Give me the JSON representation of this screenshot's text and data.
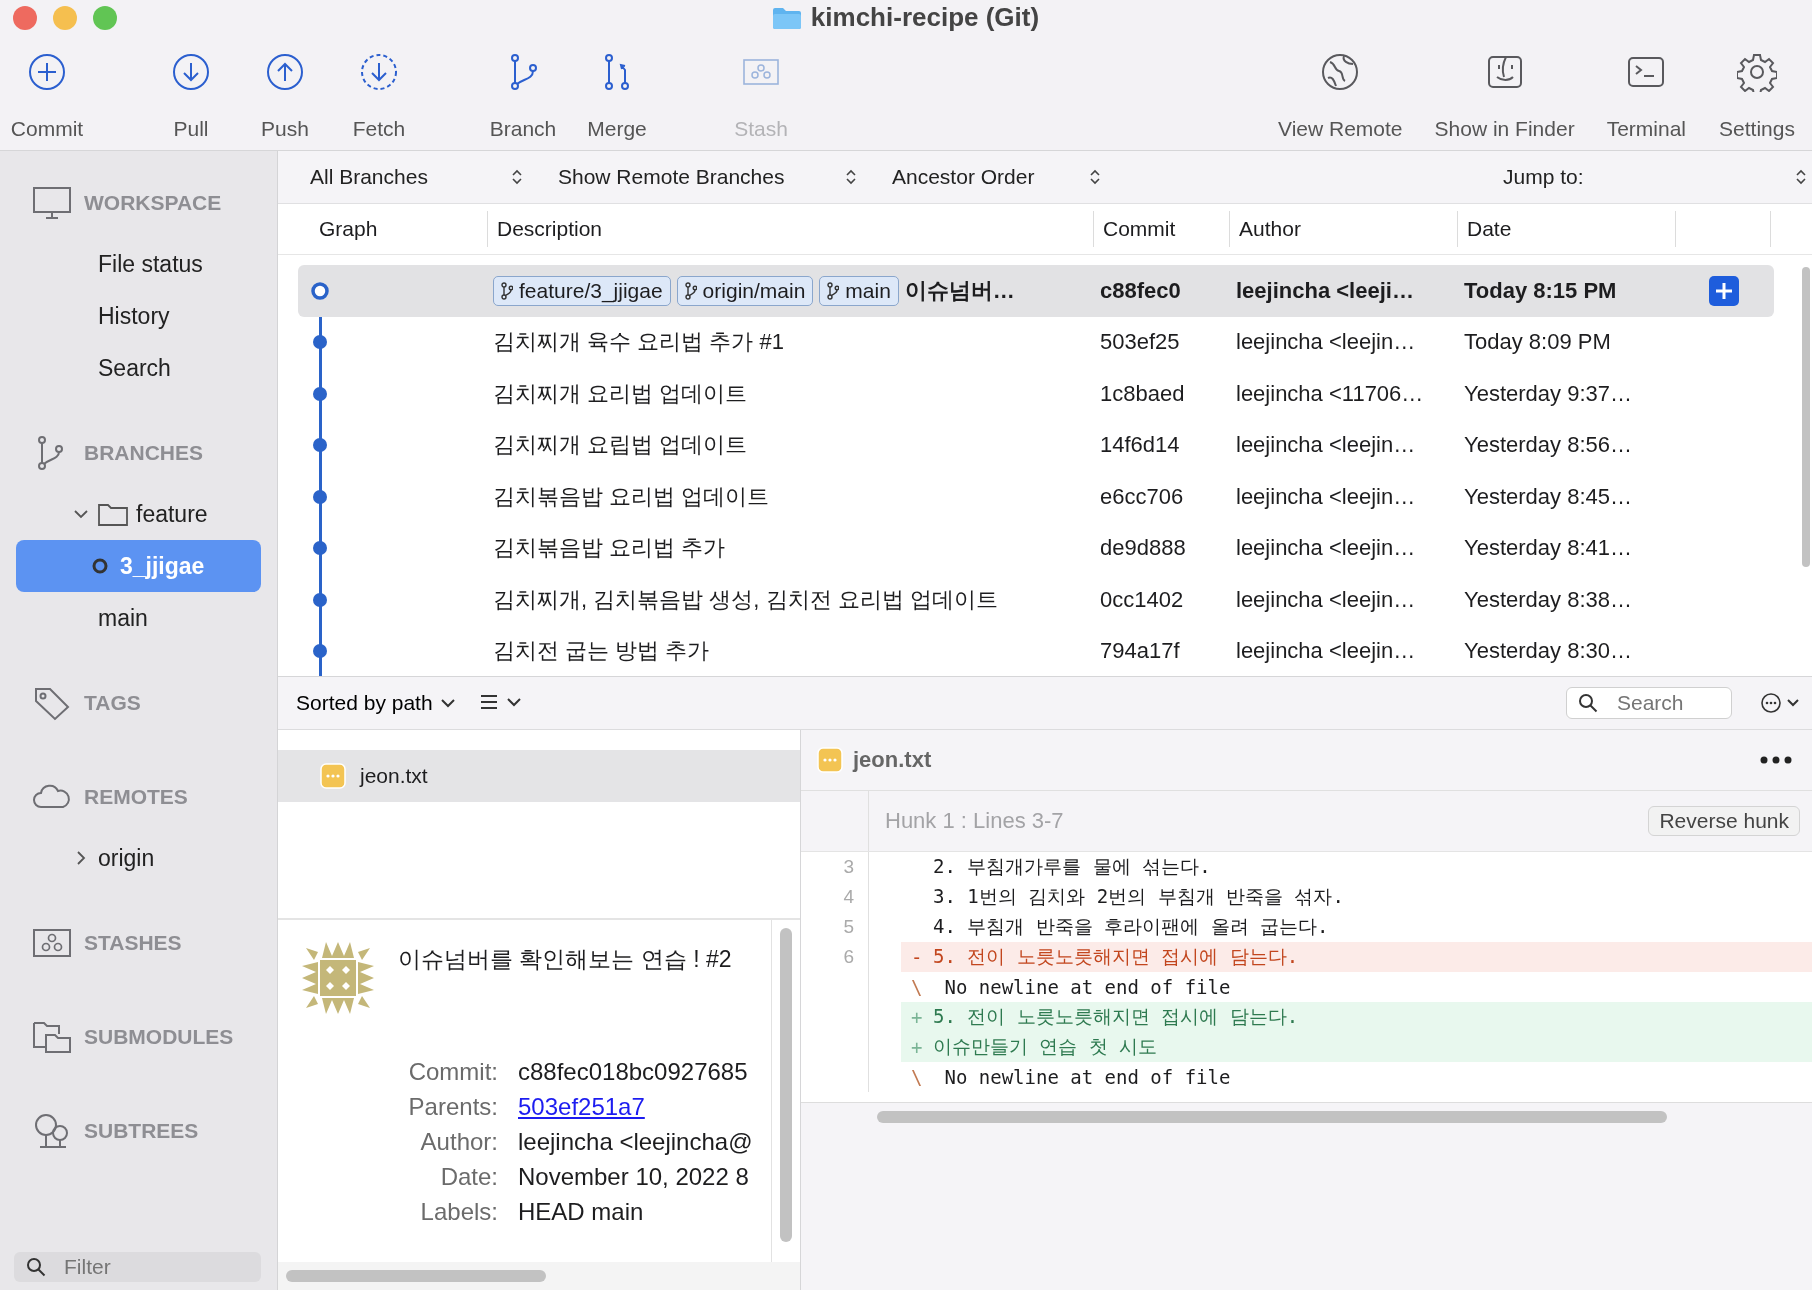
{
  "window": {
    "title": "kimchi-recipe (Git)"
  },
  "toolbar": {
    "groups": [
      [
        {
          "label": "Commit",
          "kind": "commit",
          "disabled": false
        }
      ],
      [
        {
          "label": "Pull",
          "kind": "pull",
          "disabled": false
        },
        {
          "label": "Push",
          "kind": "push",
          "disabled": false
        },
        {
          "label": "Fetch",
          "kind": "fetch",
          "disabled": false
        }
      ],
      [
        {
          "label": "Branch",
          "kind": "branch",
          "disabled": false
        },
        {
          "label": "Merge",
          "kind": "merge",
          "disabled": false
        }
      ],
      [
        {
          "label": "Stash",
          "kind": "stash",
          "disabled": true
        }
      ]
    ],
    "right": [
      {
        "label": "View Remote",
        "kind": "globe",
        "disabled": false
      },
      {
        "label": "Show in Finder",
        "kind": "finder",
        "disabled": false
      },
      {
        "label": "Terminal",
        "kind": "terminal",
        "disabled": false
      },
      {
        "label": "Settings",
        "kind": "settings",
        "disabled": false
      }
    ]
  },
  "sidebar": {
    "sections": [
      {
        "title": "WORKSPACE",
        "kind": "workspace",
        "items": [
          {
            "label": "File status",
            "selected": false
          },
          {
            "label": "History",
            "selected": false
          },
          {
            "label": "Search",
            "selected": false
          }
        ]
      },
      {
        "title": "BRANCHES",
        "kind": "branches",
        "items": [
          {
            "label": "feature",
            "kind": "folder",
            "expanded": true,
            "selected": false,
            "children": [
              {
                "label": "3_jjigae",
                "kind": "branch",
                "head": true,
                "selected": true
              }
            ]
          },
          {
            "label": "main",
            "kind": "branch",
            "head": false,
            "selected": false
          }
        ]
      },
      {
        "title": "TAGS",
        "kind": "tags"
      },
      {
        "title": "REMOTES",
        "kind": "remotes",
        "items": [
          {
            "label": "origin",
            "kind": "remote",
            "expanded": false,
            "selected": false
          }
        ]
      },
      {
        "title": "STASHES",
        "kind": "stashes"
      },
      {
        "title": "SUBMODULES",
        "kind": "submodules"
      },
      {
        "title": "SUBTREES",
        "kind": "subtrees"
      }
    ],
    "filter": {
      "placeholder": "Filter"
    }
  },
  "filter_bar": {
    "branches": "All Branches",
    "remote_branches": "Show Remote Branches",
    "order": "Ancestor Order",
    "jump_label": "Jump to:"
  },
  "commits": {
    "columns": [
      "Graph",
      "Description",
      "Commit",
      "Author",
      "Date"
    ],
    "rows": [
      {
        "selected": true,
        "head": true,
        "refs": [
          "feature/3_jjigae",
          "origin/main",
          "main"
        ],
        "description": "이슈넘버…",
        "commit": "c88fec0",
        "author": "leejincha <leeji…",
        "date": "Today 8:15 PM"
      },
      {
        "selected": false,
        "head": false,
        "description": "김치찌개 육수 요리법 추가 #1",
        "commit": "503ef25",
        "author": "leejincha <leejin…",
        "date": "Today 8:09 PM"
      },
      {
        "selected": false,
        "head": false,
        "description": "김치찌개 요리법 업데이트",
        "commit": "1c8baed",
        "author": "leejincha <11706…",
        "date": "Yesterday 9:37…"
      },
      {
        "selected": false,
        "head": false,
        "description": "김치찌개 요립법 업데이트",
        "commit": "14f6d14",
        "author": "leejincha <leejin…",
        "date": "Yesterday 8:56…"
      },
      {
        "selected": false,
        "head": false,
        "description": "김치볶음밥 요리법 업데이트",
        "commit": "e6cc706",
        "author": "leejincha <leejin…",
        "date": "Yesterday 8:45…"
      },
      {
        "selected": false,
        "head": false,
        "description": "김치볶음밥 요리법 추가",
        "commit": "de9d888",
        "author": "leejincha <leejin…",
        "date": "Yesterday 8:41…"
      },
      {
        "selected": false,
        "head": false,
        "description": "김치찌개, 김치볶음밥 생성, 김치전 요리법 업데이트",
        "commit": "0cc1402",
        "author": "leejincha <leejin…",
        "date": "Yesterday 8:38…"
      },
      {
        "selected": false,
        "head": false,
        "description": "김치전 굽는 방법 추가",
        "commit": "794a17f",
        "author": "leejincha <leejin…",
        "date": "Yesterday 8:30…"
      }
    ]
  },
  "files_bar": {
    "sort": "Sorted by path",
    "search": {
      "placeholder": "Search"
    }
  },
  "files": [
    {
      "name": "jeon.txt",
      "selected": true
    }
  ],
  "details": {
    "message": "이슈넘버를 확인해보는 연습 ! #2",
    "fields": [
      {
        "label": "Commit:",
        "value": "c88fec018bc0927685",
        "kind": "text"
      },
      {
        "label": "Parents:",
        "value": "503ef251a7",
        "kind": "link"
      },
      {
        "label": "Author:",
        "value": "leejincha <leejincha@",
        "kind": "text"
      },
      {
        "label": "Date:",
        "value": "November 10, 2022 8",
        "kind": "text"
      },
      {
        "label": "Labels:",
        "value": "HEAD main",
        "kind": "text"
      }
    ]
  },
  "diff": {
    "file": "jeon.txt",
    "hunk": "Hunk 1 : Lines 3-7",
    "reverse_button": "Reverse hunk",
    "lines": [
      {
        "number": "3",
        "kind": "context",
        "text": "2. 부침개가루를 물에 섞는다."
      },
      {
        "number": "4",
        "kind": "context",
        "text": "3. 1번의 김치와 2번의 부침개 반죽을 섞자."
      },
      {
        "number": "5",
        "kind": "context",
        "text": "4. 부침개 반죽을 후라이팬에 올려 굽는다."
      },
      {
        "number": "6",
        "kind": "removed",
        "marker": "-",
        "text": "5. 전이 노릇노릇해지면 접시에 담는다."
      },
      {
        "kind": "note",
        "marker": "\\",
        "text": " No newline at end of file"
      },
      {
        "kind": "added",
        "marker": "+",
        "text": "5. 전이 노릇노릇해지면 접시에 담는다."
      },
      {
        "kind": "added",
        "marker": "+",
        "text": "이슈만들기 연습 첫 시도"
      },
      {
        "kind": "note",
        "marker": "\\",
        "text": " No newline at end of file"
      }
    ]
  }
}
